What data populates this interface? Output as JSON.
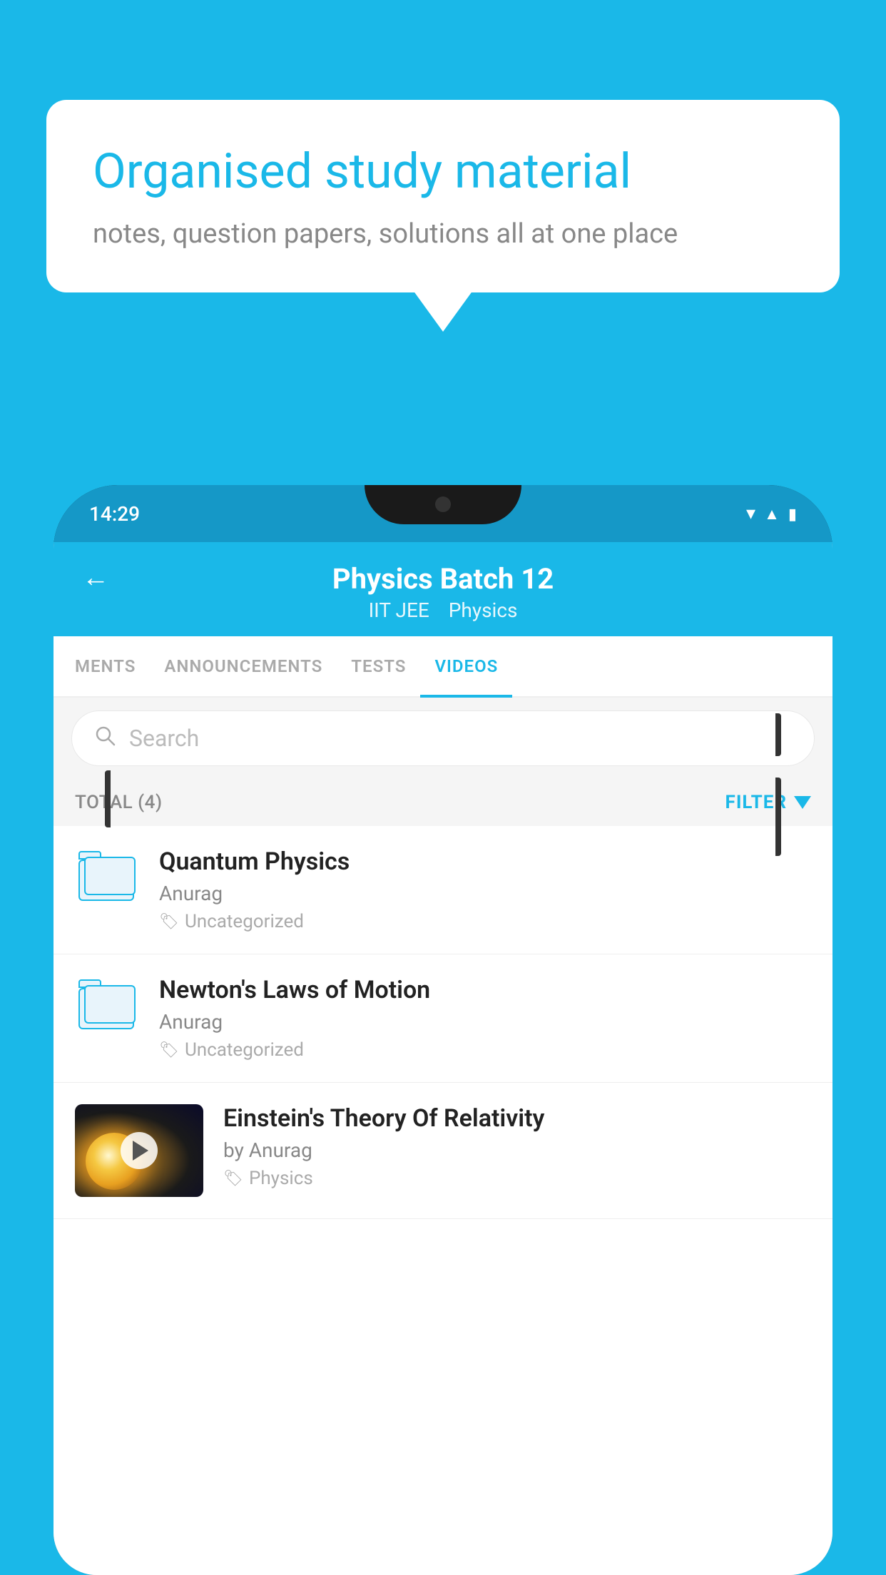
{
  "background_color": "#1ab8e8",
  "speech_bubble": {
    "title": "Organised study material",
    "subtitle": "notes, question papers, solutions all at one place"
  },
  "phone": {
    "status_bar": {
      "time": "14:29",
      "icons": [
        "wifi",
        "signal",
        "battery"
      ]
    },
    "header": {
      "back_label": "←",
      "title": "Physics Batch 12",
      "subtitle1": "IIT JEE",
      "subtitle2": "Physics"
    },
    "tabs": [
      {
        "label": "MENTS",
        "active": false
      },
      {
        "label": "ANNOUNCEMENTS",
        "active": false
      },
      {
        "label": "TESTS",
        "active": false
      },
      {
        "label": "VIDEOS",
        "active": true
      }
    ],
    "search": {
      "placeholder": "Search"
    },
    "filter_bar": {
      "total_label": "TOTAL (4)",
      "filter_label": "FILTER"
    },
    "video_list": [
      {
        "id": 1,
        "type": "folder",
        "title": "Quantum Physics",
        "author": "Anurag",
        "tag": "Uncategorized"
      },
      {
        "id": 2,
        "type": "folder",
        "title": "Newton's Laws of Motion",
        "author": "Anurag",
        "tag": "Uncategorized"
      },
      {
        "id": 3,
        "type": "video",
        "title": "Einstein's Theory Of Relativity",
        "author": "by Anurag",
        "tag": "Physics"
      }
    ]
  }
}
